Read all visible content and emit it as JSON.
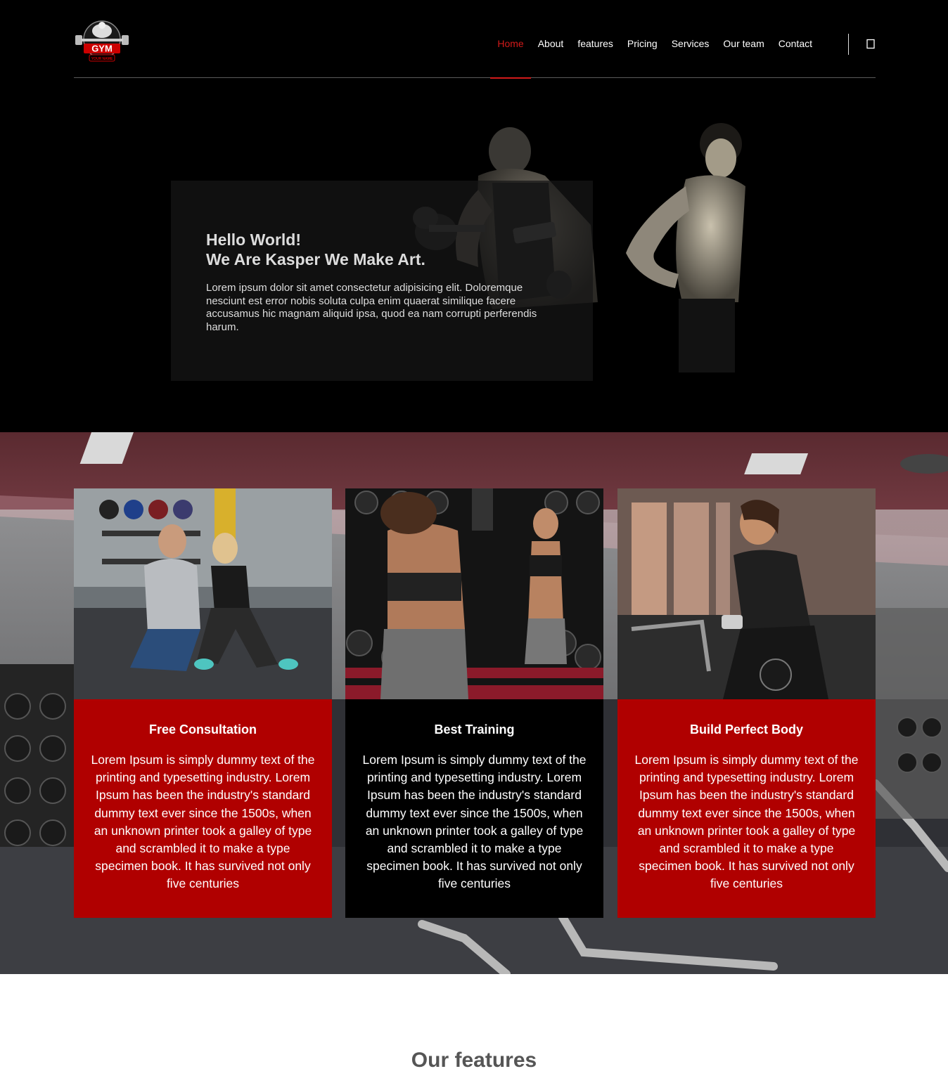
{
  "brand": {
    "logo_text": "GYM",
    "logo_subtext": "YOUR NAME"
  },
  "nav": {
    "items": [
      {
        "label": "Home"
      },
      {
        "label": "About"
      },
      {
        "label": "features"
      },
      {
        "label": "Pricing"
      },
      {
        "label": "Services"
      },
      {
        "label": "Our team"
      },
      {
        "label": "Contact"
      }
    ],
    "active": "Home",
    "icon": "square-icon"
  },
  "hero": {
    "title_line1": "Hello World!",
    "title_line2": "We Are Kasper We Make Art.",
    "text": "Lorem ipsum dolor sit amet consectetur adipisicing elit. Doloremque nesciunt est error nobis soluta culpa enim quaerat similique facere accusamus hic magnam aliquid ipsa, quod ea nam corrupti perferendis harum."
  },
  "cards": [
    {
      "title": "Free Consultation",
      "text": "Lorem Ipsum is simply dummy text of the printing and typesetting industry. Lorem Ipsum has been the industry's standard dummy text ever since the 1500s, when an unknown printer took a galley of type and scrambled it to make a type specimen book. It has survived not only five centuries"
    },
    {
      "title": "Best Training",
      "text": "Lorem Ipsum is simply dummy text of the printing and typesetting industry. Lorem Ipsum has been the industry's standard dummy text ever since the 1500s, when an unknown printer took a galley of type and scrambled it to make a type specimen book. It has survived not only five centuries"
    },
    {
      "title": "Build Perfect Body",
      "text": "Lorem Ipsum is simply dummy text of the printing and typesetting industry. Lorem Ipsum has been the industry's standard dummy text ever since the 1500s, when an unknown printer took a galley of type and scrambled it to make a type specimen book. It has survived not only five centuries"
    }
  ],
  "features": {
    "title": "Our features"
  },
  "colors": {
    "accent": "#d21a1a",
    "card_red": "#b00000",
    "card_black": "#000000"
  }
}
